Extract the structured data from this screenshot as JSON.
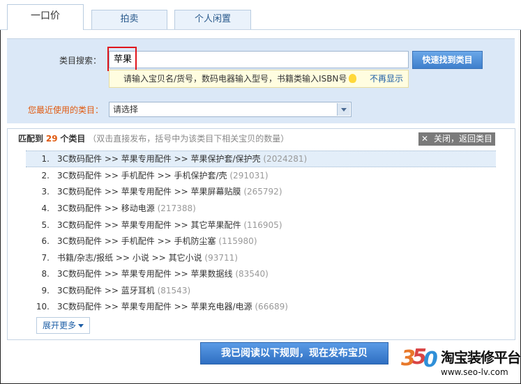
{
  "tabs": [
    "一口价",
    "拍卖",
    "个人闲置"
  ],
  "search": {
    "label": "类目搜索：",
    "value": "苹果",
    "button": "快速找到类目",
    "tip": "请输入宝贝名/货号，数码电器输入型号，书籍类输入ISBN号",
    "no_show": "不再显示"
  },
  "recent": {
    "label": "您最近使用的类目：",
    "selected": "请选择"
  },
  "results": {
    "prefix": "匹配到",
    "count": "29",
    "suffix": "个类目",
    "hint": "（双击直接发布，括号中为该类目下相关宝贝的数量）",
    "close_icon": "✕",
    "close_label": "关闭，返回类目",
    "items": [
      {
        "num": "1.",
        "path": "3C数码配件 >> 苹果专用配件 >> 苹果保护套/保护壳",
        "count": "(2024281)"
      },
      {
        "num": "2.",
        "path": "3C数码配件 >> 手机配件 >> 手机保护套/壳",
        "count": "(291031)"
      },
      {
        "num": "3.",
        "path": "3C数码配件 >> 苹果专用配件 >> 苹果屏幕贴膜",
        "count": "(265792)"
      },
      {
        "num": "4.",
        "path": "3C数码配件 >> 移动电源",
        "count": "(217388)"
      },
      {
        "num": "5.",
        "path": "3C数码配件 >> 苹果专用配件 >> 其它苹果配件",
        "count": "(116905)"
      },
      {
        "num": "6.",
        "path": "3C数码配件 >> 手机配件 >> 手机防尘塞",
        "count": "(115980)"
      },
      {
        "num": "7.",
        "path": "书籍/杂志/报纸 >> 小说 >> 其它小说",
        "count": "(93711)"
      },
      {
        "num": "8.",
        "path": "3C数码配件 >> 苹果专用配件 >> 苹果数据线",
        "count": "(83540)"
      },
      {
        "num": "9.",
        "path": "3C数码配件 >> 蓝牙耳机",
        "count": "(81543)"
      },
      {
        "num": "10.",
        "path": "3C数码配件 >> 苹果专用配件 >> 苹果充电器/电源",
        "count": "(66689)"
      }
    ],
    "more": "展开更多"
  },
  "publish": "我已阅读以下规则，现在发布宝贝",
  "watermark": {
    "logo_digits": [
      "3",
      "5",
      "0"
    ],
    "title": "淘宝装修平台",
    "url": "www.seo-lv.com"
  },
  "colors": {
    "band": "#dbe8f7",
    "accent_orange": "#e05a10",
    "link_blue": "#1d5ea6",
    "highlight_red": "#e0141b"
  }
}
